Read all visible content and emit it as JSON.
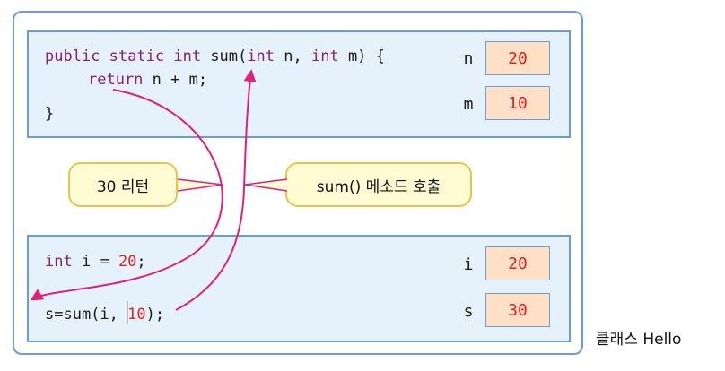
{
  "method_code": {
    "kw_public": "public",
    "kw_static": "static",
    "kw_int": "int",
    "sig_name": "sum(",
    "kw_int2": "int",
    "sig_n": "n,",
    "kw_int3": "int",
    "sig_rest": "m) {",
    "kw_return": "return",
    "ret_expr": "n + m;",
    "close_brace": "}"
  },
  "method_vars": [
    {
      "name": "n",
      "value": "20"
    },
    {
      "name": "m",
      "value": "10"
    }
  ],
  "callouts": {
    "return_label": "30 리턴",
    "call_label": "sum() 메소드 호출"
  },
  "main_code": {
    "kw_int": "int",
    "decl_left": "i =",
    "decl_num": "20",
    "decl_end": ";",
    "call_left": "s=sum(i,",
    "call_num": "10",
    "call_end": ");"
  },
  "main_vars": [
    {
      "name": "i",
      "value": "20"
    },
    {
      "name": "s",
      "value": "30"
    }
  ],
  "caption": "클래스 Hello",
  "colors": {
    "panel_border": "#6d9cd3",
    "panel_fill": "#e6f2fb",
    "value_box_fill": "#fde0c6",
    "arrow": "#e0207a",
    "keyword": "#8a1e74",
    "number": "#e0201e",
    "callout_fill": "#fffbd2",
    "callout_border": "#e8c44c"
  }
}
